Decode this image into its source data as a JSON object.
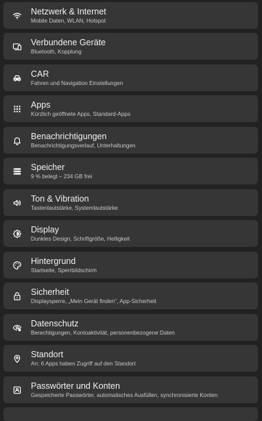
{
  "colors": {
    "background": "#222222",
    "card": "#363636",
    "title": "#f2f2f2",
    "subtitle": "#c9c9c9"
  },
  "settings": {
    "items": [
      {
        "icon": "wifi-icon",
        "title": "Netzwerk & Internet",
        "subtitle": "Mobile Daten, WLAN, Hotspot"
      },
      {
        "icon": "connected-devices-icon",
        "title": "Verbundene Geräte",
        "subtitle": "Bluetooth, Kopplung"
      },
      {
        "icon": "car-icon",
        "title": "CAR",
        "subtitle": "Fahren und Navigation Einstellungen"
      },
      {
        "icon": "apps-grid-icon",
        "title": "Apps",
        "subtitle": "Kürzlich geöffnete Apps, Standard-Apps"
      },
      {
        "icon": "bell-icon",
        "title": "Benachrichtigungen",
        "subtitle": "Benachrichtigungsverlauf, Unterhaltungen"
      },
      {
        "icon": "storage-icon",
        "title": "Speicher",
        "subtitle": "9 % belegt – 234 GB frei"
      },
      {
        "icon": "volume-icon",
        "title": "Ton & Vibration",
        "subtitle": "Tastenlautstärke, Systemlautstärke"
      },
      {
        "icon": "brightness-icon",
        "title": "Display",
        "subtitle": "Dunkles Design, Schriftgröße, Helligkeit"
      },
      {
        "icon": "palette-icon",
        "title": "Hintergrund",
        "subtitle": "Startseite, Sperrbildschirm"
      },
      {
        "icon": "lock-icon",
        "title": "Sicherheit",
        "subtitle": "Displaysperre, „Mein Gerät finden“, App-Sicherheit"
      },
      {
        "icon": "privacy-eye-icon",
        "title": "Datenschutz",
        "subtitle": "Berechtigungen, Kontoaktivität, personenbezogene Daten"
      },
      {
        "icon": "location-pin-icon",
        "title": "Standort",
        "subtitle": "An: 6 Apps haben Zugriff auf den Standort"
      },
      {
        "icon": "password-account-icon",
        "title": "Passwörter und Konten",
        "subtitle": "Gespeicherte Passwörter, automatisches Ausfüllen, synchronisierte Konten"
      }
    ]
  }
}
